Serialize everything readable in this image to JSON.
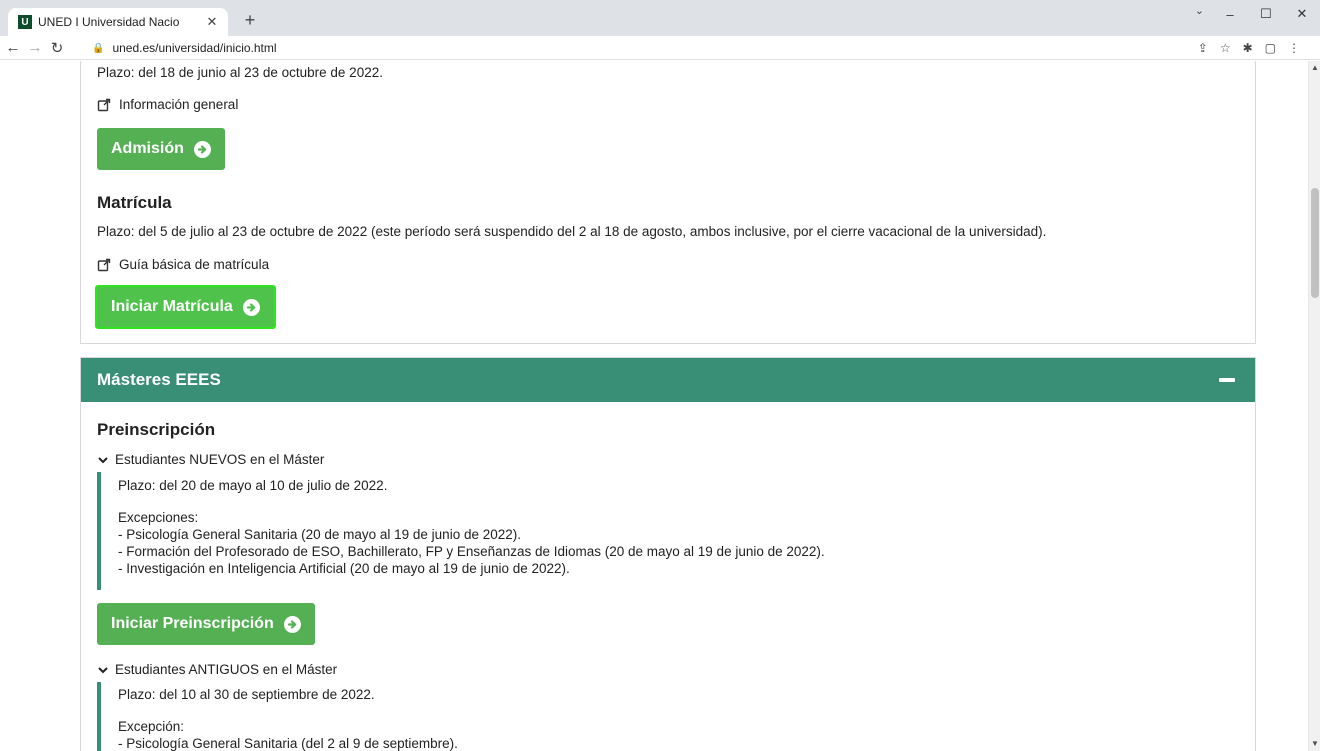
{
  "browser": {
    "tab_title": "UNED I Universidad Nacio",
    "favicon_letter": "U",
    "url": "uned.es/universidad/inicio.html"
  },
  "panel1": {
    "plazo_admision": "Plazo: del 18 de junio al 23 de octubre de 2022.",
    "info_general_link": "Información general",
    "admision_button": "Admisión",
    "matricula_heading": "Matrícula",
    "plazo_matricula": "Plazo: del 5 de julio al 23 de octubre de 2022 (este período será suspendido del 2 al 18 de agosto, ambos inclusive, por el cierre vacacional de la universidad).",
    "guia_link": "Guía básica de matrícula",
    "iniciar_matricula_button": "Iniciar Matrícula"
  },
  "panel2": {
    "title": "Másteres EEES",
    "preinscripcion_heading": "Preinscripción",
    "nuevos": {
      "toggle": "Estudiantes NUEVOS en el Máster",
      "plazo": "Plazo: del 20 de mayo al 10 de julio de 2022.",
      "excepciones_label": "Excepciones:",
      "items": [
        "- Psicología General Sanitaria (20 de mayo al 19 de junio de 2022).",
        "- Formación del Profesorado de ESO, Bachillerato, FP y Enseñanzas de Idiomas (20 de mayo al 19 de junio de 2022).",
        "- Investigación en Inteligencia Artificial (20 de mayo al 19 de junio de 2022)."
      ]
    },
    "iniciar_preinscripcion_button": "Iniciar Preinscripción",
    "antiguos": {
      "toggle": "Estudiantes ANTIGUOS en el Máster",
      "plazo": "Plazo: del 10 al 30 de septiembre de 2022.",
      "excepcion_label": "Excepción:",
      "items": [
        "- Psicología General Sanitaria (del 2 al 9 de septiembre)."
      ]
    }
  },
  "colors": {
    "accent_green": "#398e76",
    "button_green": "#55b054"
  }
}
